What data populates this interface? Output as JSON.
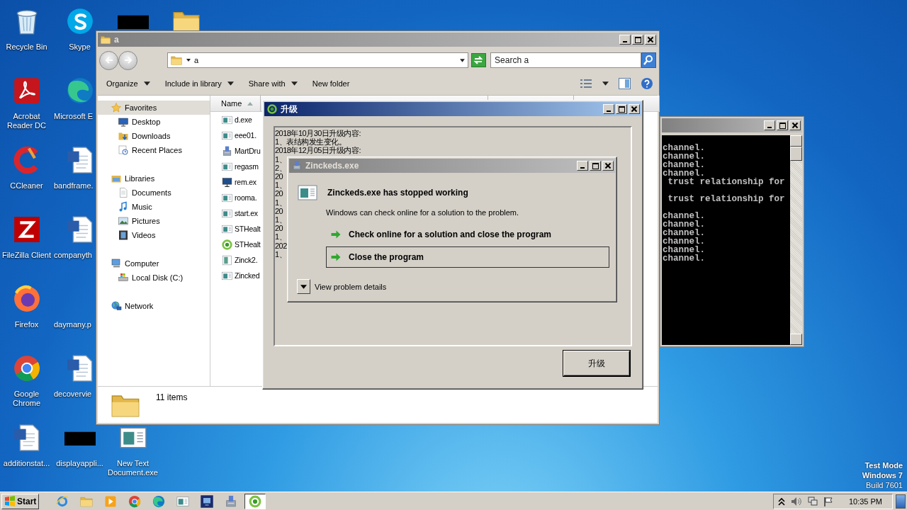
{
  "desktop": {
    "icon_columns": [
      [
        {
          "label": "Recycle Bin",
          "kind": "bin"
        },
        {
          "label": "Acrobat Reader DC",
          "kind": "acrobat"
        },
        {
          "label": "CCleaner",
          "kind": "ccleaner"
        },
        {
          "label": "FileZilla Client",
          "kind": "filezilla"
        },
        {
          "label": "Firefox",
          "kind": "firefox"
        },
        {
          "label": "Google Chrome",
          "kind": "chrome"
        },
        {
          "label": "additionstat...",
          "kind": "word"
        }
      ],
      [
        {
          "label": "Skype",
          "kind": "skype"
        },
        {
          "label": "Microsoft E",
          "kind": "edge"
        },
        {
          "label": "bandframe.",
          "kind": "word"
        },
        {
          "label": "companyth",
          "kind": "word"
        },
        {
          "label": "daymany.p",
          "kind": "blank"
        },
        {
          "label": "decovervie",
          "kind": "word"
        },
        {
          "label": "displayappli...",
          "kind": "dark"
        }
      ],
      [
        {
          "kind": "dark"
        },
        {
          "kind": "gap"
        },
        {
          "kind": "gap"
        },
        {
          "kind": "gap"
        },
        {
          "kind": "gap"
        },
        {
          "kind": "gap"
        },
        {
          "label": "New Text Document.exe",
          "kind": "exe"
        }
      ],
      [
        {
          "kind": "folder"
        }
      ]
    ],
    "build_notice": [
      "Test Mode",
      "Windows 7",
      "Build 7601"
    ]
  },
  "console": {
    "active": false,
    "lines": [
      {
        "text": "channel.",
        "gap_after": false
      },
      {
        "text": "channel.",
        "gap_after": false
      },
      {
        "text": "channel.",
        "gap_after": false
      },
      {
        "text": "channel.",
        "gap_after": false
      },
      {
        "text": " trust relationship for",
        "gap_after": true
      },
      {
        "text": " trust relationship for",
        "gap_after": true
      },
      {
        "text": "channel.",
        "gap_after": false
      },
      {
        "text": "channel.",
        "gap_after": false
      },
      {
        "text": "channel.",
        "gap_after": false
      },
      {
        "text": "channel.",
        "gap_after": false
      },
      {
        "text": "channel.",
        "gap_after": false
      },
      {
        "text": "channel.",
        "gap_after": false
      }
    ]
  },
  "explorer": {
    "title": "a",
    "active": false,
    "address": "a",
    "search": {
      "placeholder": "Search a"
    },
    "toolbar": [
      {
        "label": "Organize",
        "dropdown": true
      },
      {
        "label": "Include in library",
        "dropdown": true
      },
      {
        "label": "Share with",
        "dropdown": true
      },
      {
        "label": "New folder",
        "dropdown": false
      }
    ],
    "nav": [
      {
        "label": "Favorites",
        "kind": "star",
        "selected": true,
        "children": [
          {
            "label": "Desktop",
            "kind": "desktop",
            "selected": false
          },
          {
            "label": "Downloads",
            "kind": "downloads",
            "selected": false
          },
          {
            "label": "Recent Places",
            "kind": "recent",
            "selected": false
          }
        ]
      },
      {
        "label": "Libraries",
        "kind": "libraries",
        "selected": false,
        "children": [
          {
            "label": "Documents",
            "kind": "documents",
            "selected": false
          },
          {
            "label": "Music",
            "kind": "music",
            "selected": false
          },
          {
            "label": "Pictures",
            "kind": "pictures",
            "selected": false
          },
          {
            "label": "Videos",
            "kind": "videos",
            "selected": false
          }
        ]
      },
      {
        "label": "Computer",
        "kind": "computer",
        "selected": false,
        "children": [
          {
            "label": "Local Disk (C:)",
            "kind": "disk",
            "selected": false
          }
        ]
      },
      {
        "label": "Network",
        "kind": "network",
        "selected": false
      }
    ],
    "columns": [
      {
        "label": "Name",
        "sorted": true
      }
    ],
    "files": [
      {
        "name": "d.exe",
        "kind": "exe"
      },
      {
        "name": "eee01.",
        "kind": "exe"
      },
      {
        "name": "MartDru",
        "kind": "setup"
      },
      {
        "name": "regasm",
        "kind": "exe"
      },
      {
        "name": "rem.ex",
        "kind": "monitor"
      },
      {
        "name": "rooma.",
        "kind": "exe"
      },
      {
        "name": "start.ex",
        "kind": "exe"
      },
      {
        "name": "STHealt",
        "kind": "exe"
      },
      {
        "name": "STHealt",
        "kind": "green"
      },
      {
        "name": "Zinck2.",
        "kind": "imgexe"
      },
      {
        "name": "Zincked",
        "kind": "exe"
      }
    ],
    "status": "11 items"
  },
  "upgrade": {
    "title": "升级",
    "active": true,
    "log_lines": [
      "2018年10月30日升级内容:",
      "1、表结构发生变化。",
      "2018年12月05日升级内容:",
      "1、",
      "2、",
      "20",
      "1、",
      "20",
      "1、",
      "20",
      "1、",
      "20",
      "1、",
      "202",
      "1、"
    ],
    "button": "升级"
  },
  "error_dialog": {
    "title": "Zinckeds.exe",
    "active": false,
    "heading": "Zinckeds.exe has stopped working",
    "message": "Windows can check online for a solution to the problem.",
    "options": [
      {
        "label": "Check online for a solution and close the program",
        "selected": false
      },
      {
        "label": "Close the program",
        "selected": true
      }
    ],
    "details": "View problem details"
  },
  "taskbar": {
    "start": "Start",
    "items": [
      {
        "kind": "ie",
        "selected": false
      },
      {
        "kind": "folder",
        "selected": false
      },
      {
        "kind": "media",
        "selected": false
      },
      {
        "kind": "chrome",
        "selected": false
      },
      {
        "kind": "edge",
        "selected": false
      },
      {
        "kind": "exe",
        "selected": false
      },
      {
        "kind": "navy",
        "selected": false
      },
      {
        "kind": "setup",
        "selected": false
      },
      {
        "kind": "green",
        "selected": true
      }
    ],
    "clock": "10:35 PM"
  }
}
